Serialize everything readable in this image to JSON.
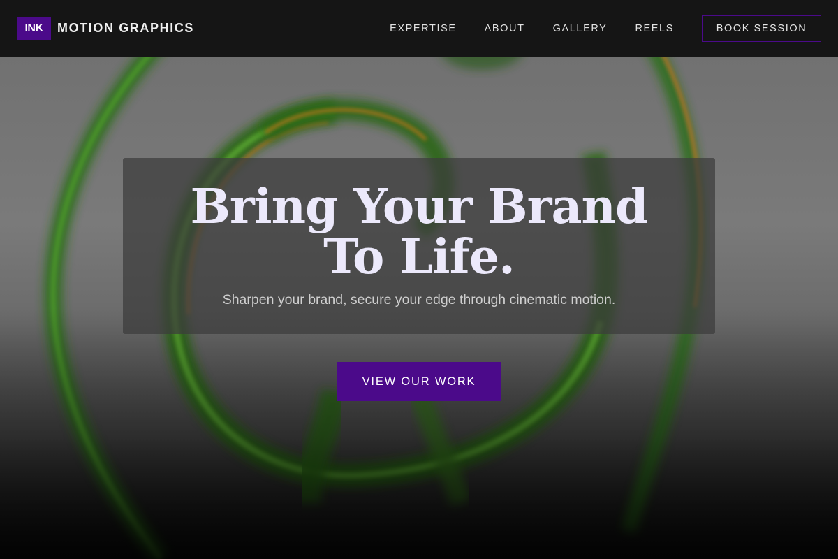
{
  "nav": {
    "logo_text": "INK",
    "brand_name": "MOTION GRAPHICS",
    "links": [
      {
        "label": "EXPERTISE"
      },
      {
        "label": "ABOUT"
      },
      {
        "label": "GALLERY"
      },
      {
        "label": "REELS"
      }
    ],
    "cta_label": "BOOK SESSION"
  },
  "hero": {
    "title": "Bring Your Brand To Life.",
    "subtitle": "Sharpen your brand, secure your edge through cinematic motion.",
    "cta_label": "VIEW OUR WORK"
  },
  "colors": {
    "accent": "#4b0a8a",
    "nav_background": "#151515",
    "title_text": "#ece9fb"
  },
  "background": {
    "description_icon": "green-ink-swirl-image"
  }
}
